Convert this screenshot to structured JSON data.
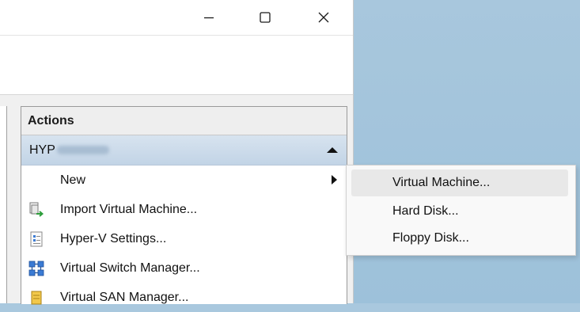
{
  "window": {
    "minimize_icon": "minimize-icon",
    "maximize_icon": "maximize-icon",
    "close_icon": "close-icon"
  },
  "actions": {
    "header": "Actions",
    "host": {
      "label": "HYP"
    },
    "items": [
      {
        "label": "New",
        "icon": "none",
        "has_submenu": true
      },
      {
        "label": "Import Virtual Machine...",
        "icon": "import-vm-icon"
      },
      {
        "label": "Hyper-V Settings...",
        "icon": "settings-icon"
      },
      {
        "label": "Virtual Switch Manager...",
        "icon": "switch-manager-icon"
      },
      {
        "label": "Virtual SAN Manager...",
        "icon": "san-manager-icon"
      }
    ]
  },
  "submenu": {
    "items": [
      {
        "label": "Virtual Machine...",
        "highlighted": true
      },
      {
        "label": "Hard Disk..."
      },
      {
        "label": "Floppy Disk..."
      }
    ]
  }
}
